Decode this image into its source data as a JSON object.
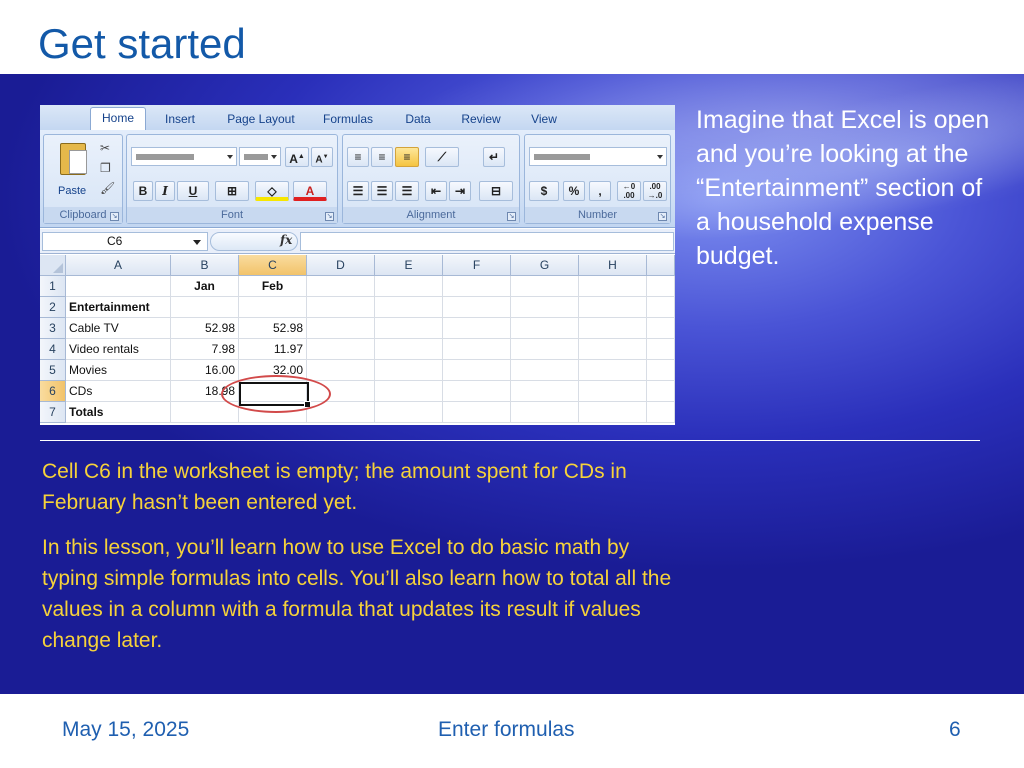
{
  "title": "Get started",
  "right_text": "Imagine that Excel is open and you’re looking at the “Entertainment” section of a household expense budget.",
  "paragraphs": [
    "Cell C6 in the worksheet is empty; the amount spent for CDs in February hasn’t been entered yet.",
    "In this lesson, you’ll learn how to use Excel to do basic math by typing simple formulas into cells. You’ll also learn how to total all the values in a column with a formula that updates its result if values change later."
  ],
  "footer": {
    "date": "May 15, 2025",
    "title": "Enter formulas",
    "page": "6"
  },
  "excel": {
    "tabs": [
      "Home",
      "Insert",
      "Page Layout",
      "Formulas",
      "Data",
      "Review",
      "View"
    ],
    "ribbon": {
      "paste": "Paste",
      "bold": "B",
      "italic": "I",
      "underline": "U",
      "groups": [
        "Clipboard",
        "Font",
        "Alignment",
        "Number"
      ]
    },
    "name_box": "C6",
    "fx_label": "fx",
    "columns": [
      "A",
      "B",
      "C",
      "D",
      "E",
      "F",
      "G",
      "H"
    ],
    "rows": [
      {
        "n": "1",
        "a": "",
        "b": "Jan",
        "c": "Feb"
      },
      {
        "n": "2",
        "a": "Entertainment",
        "b": "",
        "c": ""
      },
      {
        "n": "3",
        "a": "Cable TV",
        "b": "52.98",
        "c": "52.98"
      },
      {
        "n": "4",
        "a": "Video rentals",
        "b": "7.98",
        "c": "11.97"
      },
      {
        "n": "5",
        "a": "Movies",
        "b": "16.00",
        "c": "32.00"
      },
      {
        "n": "6",
        "a": "CDs",
        "b": "18.98",
        "c": ""
      },
      {
        "n": "7",
        "a": "Totals",
        "b": "",
        "c": ""
      }
    ],
    "colors": {
      "title": "#1359a8",
      "paragraph_text": "#f6d23a",
      "highlight_ellipse": "#d24a4a"
    }
  }
}
